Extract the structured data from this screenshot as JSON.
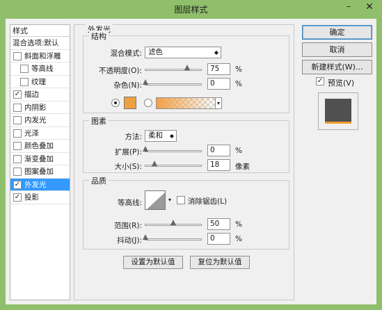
{
  "window": {
    "title": "图层样式",
    "minimize": "–",
    "close": "✕"
  },
  "style_list": {
    "header": "样式",
    "items": [
      {
        "label": "混合选项:默认",
        "checkbox": false,
        "checked": false,
        "indent": false,
        "selected": false
      },
      {
        "label": "斜面和浮雕",
        "checkbox": true,
        "checked": false,
        "indent": false,
        "selected": false
      },
      {
        "label": "等高线",
        "checkbox": true,
        "checked": false,
        "indent": true,
        "selected": false
      },
      {
        "label": "纹理",
        "checkbox": true,
        "checked": false,
        "indent": true,
        "selected": false
      },
      {
        "label": "描边",
        "checkbox": true,
        "checked": true,
        "indent": false,
        "selected": false
      },
      {
        "label": "内阴影",
        "checkbox": true,
        "checked": false,
        "indent": false,
        "selected": false
      },
      {
        "label": "内发光",
        "checkbox": true,
        "checked": false,
        "indent": false,
        "selected": false
      },
      {
        "label": "光泽",
        "checkbox": true,
        "checked": false,
        "indent": false,
        "selected": false
      },
      {
        "label": "颜色叠加",
        "checkbox": true,
        "checked": false,
        "indent": false,
        "selected": false
      },
      {
        "label": "渐变叠加",
        "checkbox": true,
        "checked": false,
        "indent": false,
        "selected": false
      },
      {
        "label": "图案叠加",
        "checkbox": true,
        "checked": false,
        "indent": false,
        "selected": false
      },
      {
        "label": "外发光",
        "checkbox": true,
        "checked": true,
        "indent": false,
        "selected": true
      },
      {
        "label": "投影",
        "checkbox": true,
        "checked": true,
        "indent": false,
        "selected": false
      }
    ]
  },
  "outer_glow": {
    "title": "外发光",
    "structure": {
      "title": "结构",
      "blend_mode_label": "混合模式:",
      "blend_mode_value": "滤色",
      "opacity_label": "不透明度(O):",
      "opacity_value": "75",
      "opacity_unit": "%",
      "noise_label": "杂色(N):",
      "noise_value": "0",
      "noise_unit": "%",
      "solid_color_selected": true,
      "swatch_color": "#f0a040",
      "gradient_color": "#f0a046"
    },
    "elements": {
      "title": "图素",
      "technique_label": "方法:",
      "technique_value": "柔和",
      "spread_label": "扩展(P):",
      "spread_value": "0",
      "spread_unit": "%",
      "size_label": "大小(S):",
      "size_value": "18",
      "size_unit": "像素"
    },
    "quality": {
      "title": "品质",
      "contour_label": "等高线:",
      "antialias_label": "消除锯齿(L)",
      "antialias_checked": false,
      "range_label": "范围(R):",
      "range_value": "50",
      "range_unit": "%",
      "jitter_label": "抖动(J):",
      "jitter_value": "0",
      "jitter_unit": "%"
    },
    "make_default_label": "设置为默认值",
    "reset_default_label": "复位为默认值"
  },
  "actions": {
    "ok_label": "确定",
    "cancel_label": "取消",
    "new_style_label": "新建样式(W)...",
    "preview_label": "预览(V)",
    "preview_checked": true
  },
  "colors": {
    "accent_selected": "#3399ff",
    "window_frame": "#8fbf6b"
  }
}
